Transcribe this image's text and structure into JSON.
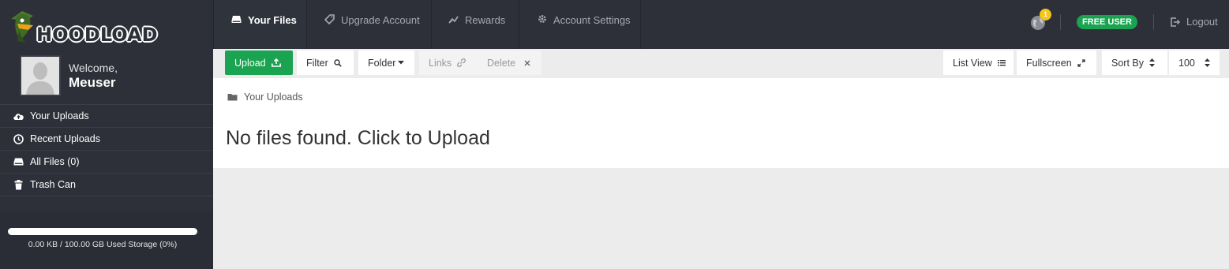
{
  "brand": {
    "logo_text": "HOODLOAD"
  },
  "nav": {
    "tabs": [
      {
        "label": "Your Files",
        "icon": "drive-icon",
        "active": true
      },
      {
        "label": "Upgrade Account",
        "icon": "tag-icon",
        "active": false
      },
      {
        "label": "Rewards",
        "icon": "chart-line-icon",
        "active": false
      },
      {
        "label": "Account Settings",
        "icon": "gear-icon",
        "active": false
      }
    ]
  },
  "header": {
    "notifications_count": "1",
    "account_badge": "FREE USER",
    "logout_label": "Logout"
  },
  "sidebar": {
    "welcome": "Welcome,",
    "username": "Meuser",
    "items": [
      {
        "label": "Your Uploads",
        "icon": "cloud-upload-icon"
      },
      {
        "label": "Recent Uploads",
        "icon": "clock-icon"
      },
      {
        "label": "All Files (0)",
        "icon": "drive-icon"
      },
      {
        "label": "Trash Can",
        "icon": "trash-icon"
      }
    ],
    "storage": {
      "text": "0.00 KB / 100.00 GB Used Storage (0%)",
      "used_fraction": 0
    }
  },
  "toolbar": {
    "upload": "Upload",
    "filter": "Filter",
    "folder": "Folder",
    "links": "Links",
    "delete": "Delete",
    "list_view": "List View",
    "fullscreen": "Fullscreen",
    "sort_by": "Sort By",
    "per_page": "100"
  },
  "main": {
    "breadcrumb": "Your Uploads",
    "empty_message": "No files found. Click to Upload"
  },
  "colors": {
    "topbar": "#2d3039",
    "accent_green": "#1aa350",
    "badge_yellow": "#f5c518"
  }
}
